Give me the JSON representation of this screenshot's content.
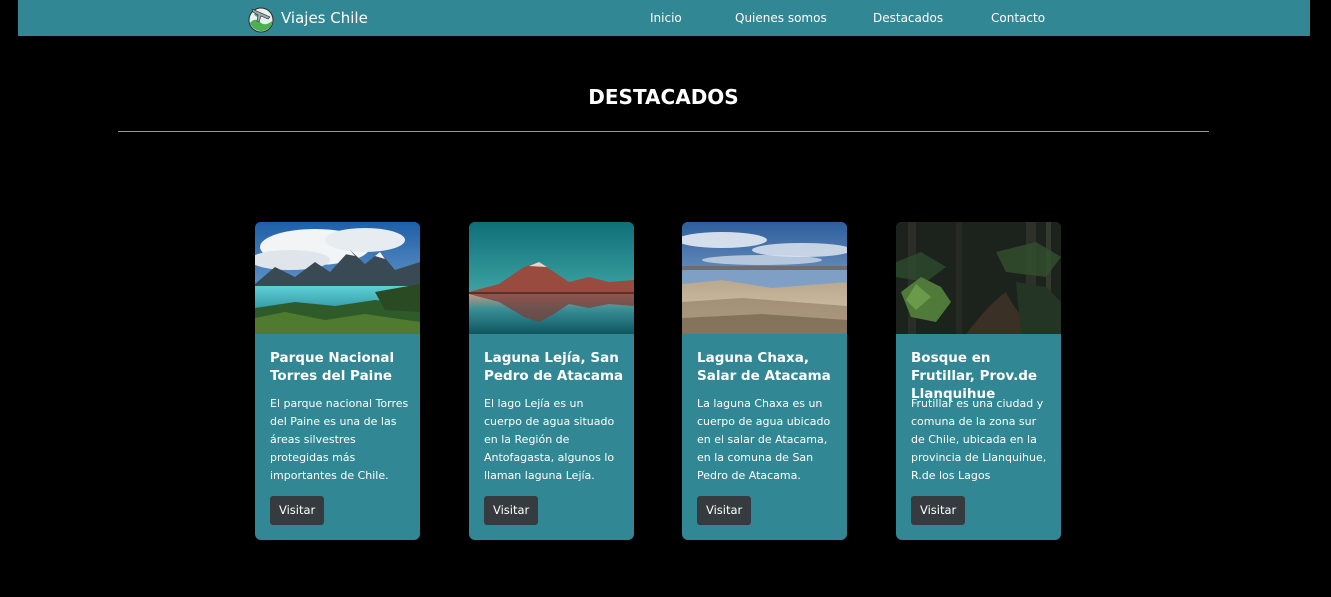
{
  "navbar": {
    "brand": "Viajes Chile",
    "logo_icon": "globe-airplane-icon",
    "links": [
      "Inicio",
      "Quienes somos",
      "Destacados",
      "Contacto"
    ]
  },
  "section": {
    "title": "DESTACADOS"
  },
  "cards": [
    {
      "title": "Parque Nacional Torres del Paine",
      "text": "El parque nacional Torres del Paine es una de las áreas silvestres protegidas más importantes de Chile.",
      "button": "Visitar",
      "image": "torres-del-paine-landscape"
    },
    {
      "title": "Laguna Lejía, San Pedro de Atacama",
      "text": "El lago Lejía es un cuerpo de agua situado en la Región de Antofagasta, algunos lo llaman laguna Lejía.",
      "button": "Visitar",
      "image": "laguna-lejia-volcano-reflection"
    },
    {
      "title": "Laguna Chaxa, Salar de Atacama",
      "text": "La laguna Chaxa es un cuerpo de agua ubicado en el salar de Atacama, en la comuna de San Pedro de Atacama.",
      "button": "Visitar",
      "image": "laguna-chaxa-salt-flat"
    },
    {
      "title": "Bosque en Frutillar, Prov.de Llanquihue",
      "text": "Frutillar es una ciudad y comuna de la zona sur de Chile, ubicada en la provincia de Llanquihue, R.de los Lagos",
      "button": "Visitar",
      "image": "frutillar-forest"
    }
  ],
  "colors": {
    "navbar_bg": "#318793",
    "card_bg": "#318793",
    "button_bg": "#363b40",
    "page_bg": "#000000"
  }
}
